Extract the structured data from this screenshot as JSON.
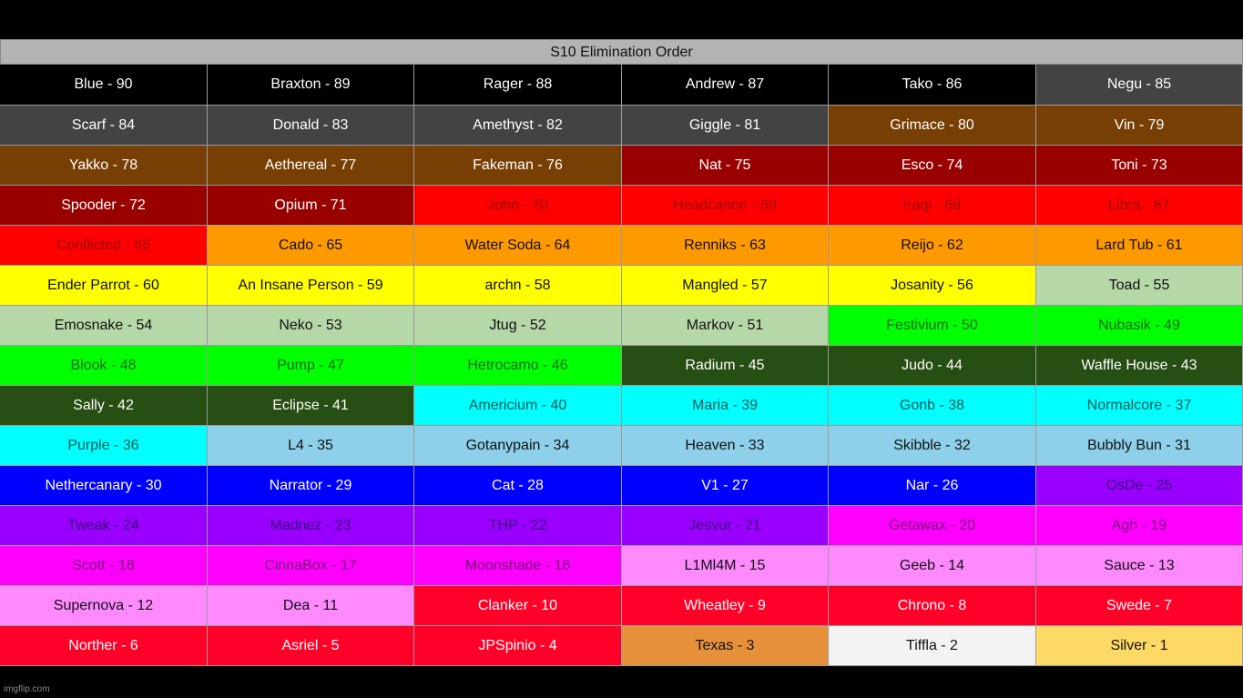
{
  "title": "S10 Elimination Order",
  "watermark": "imgflip.com",
  "colors": {
    "black": "#000000",
    "darkgray": "#434343",
    "brown": "#783f04",
    "darkred": "#990000",
    "red": "#ff0000",
    "orange": "#ff9900",
    "yellow": "#ffff00",
    "sage": "#b6d7a8",
    "green": "#00ff00",
    "darkgreen": "#274e13",
    "cyan": "#00ffff",
    "lightblue": "#8ed0ea",
    "blue": "#0000ff",
    "violet": "#9900ff",
    "magenta": "#ff00ff",
    "pink": "#ff8aff",
    "crimson": "#ff0028",
    "bronze": "#e6913a",
    "whitish": "#f3f3f3",
    "gold": "#ffd966"
  },
  "cells": [
    {
      "text": "Blue - 90",
      "bg": "black",
      "fg": "#ffffff"
    },
    {
      "text": "Braxton - 89",
      "bg": "black",
      "fg": "#ffffff"
    },
    {
      "text": "Rager - 88",
      "bg": "black",
      "fg": "#ffffff"
    },
    {
      "text": "Andrew - 87",
      "bg": "black",
      "fg": "#ffffff"
    },
    {
      "text": "Tako - 86",
      "bg": "black",
      "fg": "#ffffff"
    },
    {
      "text": "Negu - 85",
      "bg": "darkgray",
      "fg": "#ffffff"
    },
    {
      "text": "Scarf - 84",
      "bg": "darkgray",
      "fg": "#ffffff"
    },
    {
      "text": "Donald - 83",
      "bg": "darkgray",
      "fg": "#ffffff"
    },
    {
      "text": "Amethyst - 82",
      "bg": "darkgray",
      "fg": "#ffffff"
    },
    {
      "text": "Giggle - 81",
      "bg": "darkgray",
      "fg": "#ffffff"
    },
    {
      "text": "Grimace - 80",
      "bg": "brown",
      "fg": "#ffffff"
    },
    {
      "text": "Vin - 79",
      "bg": "brown",
      "fg": "#ffffff"
    },
    {
      "text": "Yakko - 78",
      "bg": "brown",
      "fg": "#ffffff"
    },
    {
      "text": "Aethereal - 77",
      "bg": "brown",
      "fg": "#ffffff"
    },
    {
      "text": "Fakeman - 76",
      "bg": "brown",
      "fg": "#ffffff"
    },
    {
      "text": "Nat - 75",
      "bg": "darkred",
      "fg": "#ffffff"
    },
    {
      "text": "Esco - 74",
      "bg": "darkred",
      "fg": "#ffffff"
    },
    {
      "text": "Toni - 73",
      "bg": "darkred",
      "fg": "#ffffff"
    },
    {
      "text": "Spooder - 72",
      "bg": "darkred",
      "fg": "#ffffff"
    },
    {
      "text": "Opium - 71",
      "bg": "darkred",
      "fg": "#ffffff"
    },
    {
      "text": "John - 70",
      "bg": "red",
      "fg": "#9a0000"
    },
    {
      "text": "Headcanon - 69",
      "bg": "red",
      "fg": "#9a0000"
    },
    {
      "text": "Iraqi - 68",
      "bg": "red",
      "fg": "#9a0000"
    },
    {
      "text": "Libra - 67",
      "bg": "red",
      "fg": "#9a0000"
    },
    {
      "text": "Conflicted - 66",
      "bg": "red",
      "fg": "#9a0000"
    },
    {
      "text": "Cado - 65",
      "bg": "orange",
      "fg": "#111111"
    },
    {
      "text": "Water Soda - 64",
      "bg": "orange",
      "fg": "#111111"
    },
    {
      "text": "Renniks - 63",
      "bg": "orange",
      "fg": "#111111"
    },
    {
      "text": "Reijo - 62",
      "bg": "orange",
      "fg": "#111111"
    },
    {
      "text": "Lard Tub - 61",
      "bg": "orange",
      "fg": "#111111"
    },
    {
      "text": "Ender Parrot - 60",
      "bg": "yellow",
      "fg": "#111111"
    },
    {
      "text": "An Insane Person - 59",
      "bg": "yellow",
      "fg": "#111111"
    },
    {
      "text": "archn - 58",
      "bg": "yellow",
      "fg": "#111111"
    },
    {
      "text": "Mangled - 57",
      "bg": "yellow",
      "fg": "#111111"
    },
    {
      "text": "Josanity - 56",
      "bg": "yellow",
      "fg": "#111111"
    },
    {
      "text": "Toad - 55",
      "bg": "sage",
      "fg": "#111111"
    },
    {
      "text": "Emosnake - 54",
      "bg": "sage",
      "fg": "#111111"
    },
    {
      "text": "Neko - 53",
      "bg": "sage",
      "fg": "#111111"
    },
    {
      "text": "Jtug - 52",
      "bg": "sage",
      "fg": "#111111"
    },
    {
      "text": "Markov - 51",
      "bg": "sage",
      "fg": "#111111"
    },
    {
      "text": "Festivium - 50",
      "bg": "green",
      "fg": "#1a6a1a"
    },
    {
      "text": "Nubasik - 49",
      "bg": "green",
      "fg": "#1a6a1a"
    },
    {
      "text": "Blook - 48",
      "bg": "green",
      "fg": "#1a6a1a"
    },
    {
      "text": "Pump - 47",
      "bg": "green",
      "fg": "#1a6a1a"
    },
    {
      "text": "Hetrocamo - 46",
      "bg": "green",
      "fg": "#1a6a1a"
    },
    {
      "text": "Radium - 45",
      "bg": "darkgreen",
      "fg": "#ffffff"
    },
    {
      "text": "Judo - 44",
      "bg": "darkgreen",
      "fg": "#ffffff"
    },
    {
      "text": "Waffle House - 43",
      "bg": "darkgreen",
      "fg": "#ffffff"
    },
    {
      "text": "Sally - 42",
      "bg": "darkgreen",
      "fg": "#ffffff"
    },
    {
      "text": "Eclipse - 41",
      "bg": "darkgreen",
      "fg": "#ffffff"
    },
    {
      "text": "Americium - 40",
      "bg": "cyan",
      "fg": "#0a5a5a"
    },
    {
      "text": "Maria - 39",
      "bg": "cyan",
      "fg": "#0a5a5a"
    },
    {
      "text": "Gonb - 38",
      "bg": "cyan",
      "fg": "#0a5a5a"
    },
    {
      "text": "Normalcore - 37",
      "bg": "cyan",
      "fg": "#0a5a5a"
    },
    {
      "text": "Purple - 36",
      "bg": "cyan",
      "fg": "#0a5a5a"
    },
    {
      "text": "L4 - 35",
      "bg": "lightblue",
      "fg": "#111111"
    },
    {
      "text": "Gotanypain - 34",
      "bg": "lightblue",
      "fg": "#111111"
    },
    {
      "text": "Heaven - 33",
      "bg": "lightblue",
      "fg": "#111111"
    },
    {
      "text": "Skibble - 32",
      "bg": "lightblue",
      "fg": "#111111"
    },
    {
      "text": "Bubbly Bun - 31",
      "bg": "lightblue",
      "fg": "#111111"
    },
    {
      "text": "Nethercanary - 30",
      "bg": "blue",
      "fg": "#ffffff"
    },
    {
      "text": "Narrator - 29",
      "bg": "blue",
      "fg": "#ffffff"
    },
    {
      "text": "Cat - 28",
      "bg": "blue",
      "fg": "#ffffff"
    },
    {
      "text": "V1 - 27",
      "bg": "blue",
      "fg": "#ffffff"
    },
    {
      "text": "Nar - 26",
      "bg": "blue",
      "fg": "#ffffff"
    },
    {
      "text": "OsDe - 25",
      "bg": "violet",
      "fg": "#3b007a"
    },
    {
      "text": "Tweak - 24",
      "bg": "violet",
      "fg": "#3b007a"
    },
    {
      "text": "Madnez - 23",
      "bg": "violet",
      "fg": "#3b007a"
    },
    {
      "text": "THP - 22",
      "bg": "violet",
      "fg": "#3b007a"
    },
    {
      "text": "Jesvur - 21",
      "bg": "violet",
      "fg": "#3b007a"
    },
    {
      "text": "Getawax - 20",
      "bg": "magenta",
      "fg": "#7a007a"
    },
    {
      "text": "Agh - 19",
      "bg": "magenta",
      "fg": "#7a007a"
    },
    {
      "text": "Scott - 18",
      "bg": "magenta",
      "fg": "#7a007a"
    },
    {
      "text": "CinnaBox - 17",
      "bg": "magenta",
      "fg": "#7a007a"
    },
    {
      "text": "Moonshade - 16",
      "bg": "magenta",
      "fg": "#7a007a"
    },
    {
      "text": "L1Ml4M - 15",
      "bg": "pink",
      "fg": "#111111"
    },
    {
      "text": "Geeb - 14",
      "bg": "pink",
      "fg": "#111111"
    },
    {
      "text": "Sauce - 13",
      "bg": "pink",
      "fg": "#111111"
    },
    {
      "text": "Supernova - 12",
      "bg": "pink",
      "fg": "#111111"
    },
    {
      "text": "Dea - 11",
      "bg": "pink",
      "fg": "#111111"
    },
    {
      "text": "Clanker - 10",
      "bg": "crimson",
      "fg": "#ffffff"
    },
    {
      "text": "Wheatley - 9",
      "bg": "crimson",
      "fg": "#ffffff"
    },
    {
      "text": "Chrono - 8",
      "bg": "crimson",
      "fg": "#ffffff"
    },
    {
      "text": "Swede - 7",
      "bg": "crimson",
      "fg": "#ffffff"
    },
    {
      "text": "Norther - 6",
      "bg": "crimson",
      "fg": "#ffffff"
    },
    {
      "text": "Asriel - 5",
      "bg": "crimson",
      "fg": "#ffffff"
    },
    {
      "text": "JPSpinio - 4",
      "bg": "crimson",
      "fg": "#ffffff"
    },
    {
      "text": "Texas - 3",
      "bg": "bronze",
      "fg": "#111111"
    },
    {
      "text": "Tiffla - 2",
      "bg": "whitish",
      "fg": "#111111"
    },
    {
      "text": "Silver - 1",
      "bg": "gold",
      "fg": "#111111"
    }
  ]
}
